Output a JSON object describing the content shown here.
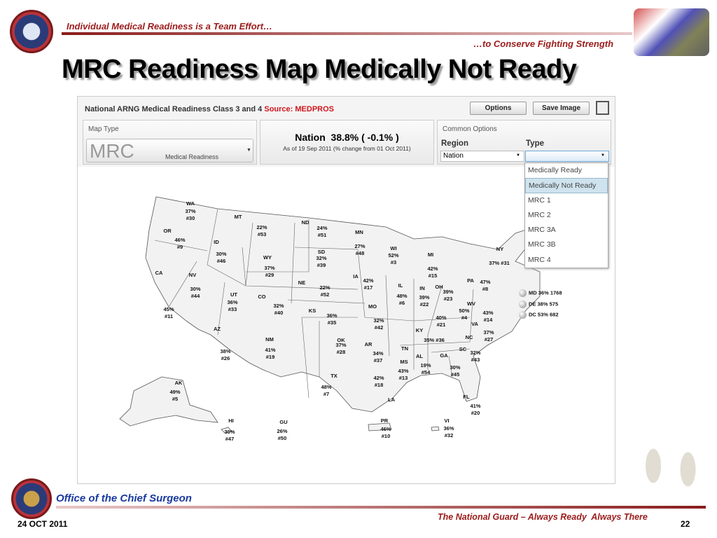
{
  "slide": {
    "tagline": "Individual Medical Readiness is a Team Effort…",
    "subtagline": "…to Conserve Fighting Strength",
    "title": "MRC Readiness Map Medically Not Ready",
    "footer_office": "Office of the Chief Surgeon",
    "footer_date": "24 OCT 2011",
    "footer_motto": "The National Guard – Always Ready  Always There",
    "page_number": "22"
  },
  "app": {
    "title": "National ARNG Medical Readiness Class 3 and 4",
    "source": "Source: MEDPROS",
    "options_button": "Options",
    "save_button": "Save Image",
    "map_type": {
      "label": "Map Type",
      "value_big": "MRC",
      "value_small": "Medical Readiness"
    },
    "nation": {
      "headline": "Nation  38.8% ( -0.1% )",
      "subline": "As of 19 Sep 2011 (% change from 01 Oct 2011)"
    },
    "common_options": {
      "label": "Common Options",
      "region_label": "Region",
      "region_value": "Nation",
      "type_label": "Type",
      "type_value": ""
    },
    "type_options": [
      "Medically Ready",
      "Medically Not Ready",
      "MRC 1",
      "MRC 2",
      "MRC 3A",
      "MRC 3B",
      "MRC 4"
    ],
    "type_selected": "Medically Not Ready",
    "accent_color": "#d0161b"
  },
  "map": {
    "states": [
      {
        "abbr": "WA",
        "pct": "37%",
        "rank": "#30"
      },
      {
        "abbr": "OR",
        "pct": "46%",
        "rank": "#9"
      },
      {
        "abbr": "ID",
        "pct": "30%",
        "rank": "#46"
      },
      {
        "abbr": "MT",
        "pct": "22%",
        "rank": "#53"
      },
      {
        "abbr": "ND",
        "pct": "24%",
        "rank": "#51"
      },
      {
        "abbr": "MN",
        "pct": "27%",
        "rank": "#48"
      },
      {
        "abbr": "SD",
        "pct": "32%",
        "rank": "#39"
      },
      {
        "abbr": "WY",
        "pct": "37%",
        "rank": "#29"
      },
      {
        "abbr": "CA",
        "pct": "45%",
        "rank": "#11"
      },
      {
        "abbr": "NV",
        "pct": "30%",
        "rank": "#44"
      },
      {
        "abbr": "UT",
        "pct": "36%",
        "rank": "#33"
      },
      {
        "abbr": "CO",
        "pct": "32%",
        "rank": "#40"
      },
      {
        "abbr": "NE",
        "pct": "22%",
        "rank": "#52"
      },
      {
        "abbr": "IA",
        "pct": "42%",
        "rank": "#17"
      },
      {
        "abbr": "KS",
        "pct": "36%",
        "rank": "#35"
      },
      {
        "abbr": "MO",
        "pct": "32%",
        "rank": "#42"
      },
      {
        "abbr": "WI",
        "pct": "52%",
        "rank": "#3"
      },
      {
        "abbr": "MI",
        "pct": "42%",
        "rank": "#15"
      },
      {
        "abbr": "IL",
        "pct": "48%",
        "rank": "#6"
      },
      {
        "abbr": "IN",
        "pct": "39%",
        "rank": "#22"
      },
      {
        "abbr": "OH",
        "pct": "39%",
        "rank": "#23"
      },
      {
        "abbr": "NY",
        "pct": "37%",
        "rank": "#31"
      },
      {
        "abbr": "PA",
        "pct": "47%",
        "rank": "#8"
      },
      {
        "abbr": "WV",
        "pct": "50%",
        "rank": "#4"
      },
      {
        "abbr": "VA",
        "pct": "43%",
        "rank": "#14"
      },
      {
        "abbr": "KY",
        "pct": "40%",
        "rank": "#21"
      },
      {
        "abbr": "TN",
        "pct": "35%",
        "rank": "#36"
      },
      {
        "abbr": "NC",
        "pct": "37%",
        "rank": "#27"
      },
      {
        "abbr": "SC",
        "pct": "32%",
        "rank": "#43"
      },
      {
        "abbr": "GA",
        "pct": "30%",
        "rank": "#45"
      },
      {
        "abbr": "AL",
        "pct": "19%",
        "rank": "#54"
      },
      {
        "abbr": "MS",
        "pct": "43%",
        "rank": "#13"
      },
      {
        "abbr": "AR",
        "pct": "34%",
        "rank": "#37"
      },
      {
        "abbr": "LA",
        "pct": "42%",
        "rank": "#18"
      },
      {
        "abbr": "TX",
        "pct": "48%",
        "rank": "#7"
      },
      {
        "abbr": "OK",
        "pct": "37%",
        "rank": "#28"
      },
      {
        "abbr": "AZ",
        "pct": "38%",
        "rank": "#26"
      },
      {
        "abbr": "NM",
        "pct": "41%",
        "rank": "#19"
      },
      {
        "abbr": "FL",
        "pct": "41%",
        "rank": "#20"
      },
      {
        "abbr": "AK",
        "pct": "49%",
        "rank": "#5"
      },
      {
        "abbr": "HI",
        "pct": "30%",
        "rank": "#47"
      },
      {
        "abbr": "GU",
        "pct": "26%",
        "rank": "#50"
      },
      {
        "abbr": "PR",
        "pct": "46%",
        "rank": "#10"
      },
      {
        "abbr": "VI",
        "pct": "36%",
        "rank": "#32"
      }
    ],
    "small_states": [
      {
        "label": "MD  36% 1768"
      },
      {
        "label": "DE  38% 575"
      },
      {
        "label": "DC  53% 682"
      }
    ]
  }
}
